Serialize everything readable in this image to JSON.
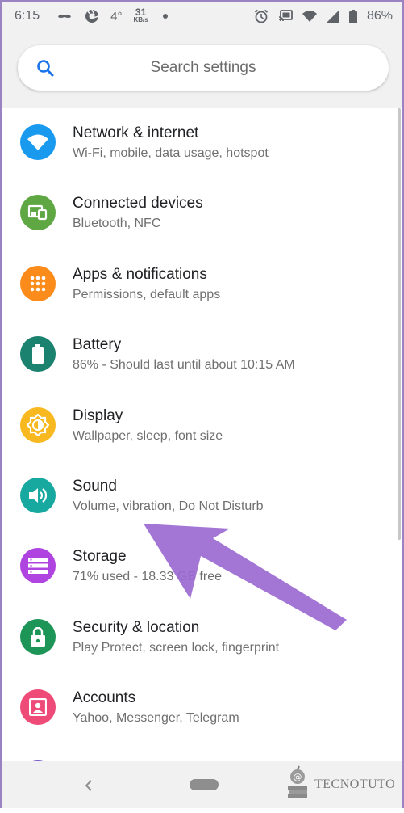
{
  "status_bar": {
    "time": "6:15",
    "temperature": "4°",
    "data_speed_value": "31",
    "data_speed_unit": "KB/s",
    "battery_percent": "86%",
    "icons": [
      "mustache-icon",
      "camera-shutter-icon",
      "dot-icon",
      "alarm-icon",
      "cast-icon",
      "wifi-icon",
      "signal-icon",
      "battery-icon"
    ]
  },
  "search": {
    "placeholder": "Search settings",
    "icon": "search-icon",
    "accent": "#1a73e8"
  },
  "settings": [
    {
      "title": "Network & internet",
      "subtitle": "Wi-Fi, mobile, data usage, hotspot",
      "icon": "wifi-icon",
      "color": "#1a9aef"
    },
    {
      "title": "Connected devices",
      "subtitle": "Bluetooth, NFC",
      "icon": "devices-icon",
      "color": "#5fa743"
    },
    {
      "title": "Apps & notifications",
      "subtitle": "Permissions, default apps",
      "icon": "apps-grid-icon",
      "color": "#fb8c1c"
    },
    {
      "title": "Battery",
      "subtitle": "86% - Should last until about 10:15 AM",
      "icon": "battery-icon",
      "color": "#1b8270"
    },
    {
      "title": "Display",
      "subtitle": "Wallpaper, sleep, font size",
      "icon": "brightness-icon",
      "color": "#f8b81f"
    },
    {
      "title": "Sound",
      "subtitle": "Volume, vibration, Do Not Disturb",
      "icon": "volume-icon",
      "color": "#17a8a0"
    },
    {
      "title": "Storage",
      "subtitle": "71% used - 18.33 GB free",
      "icon": "storage-icon",
      "color": "#b044e0"
    },
    {
      "title": "Security & location",
      "subtitle": "Play Protect, screen lock, fingerprint",
      "icon": "lock-icon",
      "color": "#1d9557"
    },
    {
      "title": "Accounts",
      "subtitle": "Yahoo, Messenger, Telegram",
      "icon": "account-icon",
      "color": "#ee4b78"
    }
  ],
  "annotation": {
    "arrow_color": "#9b6ad1",
    "arrow_target": "Sound"
  },
  "nav_bar": {
    "back_icon": "back-chevron-icon",
    "home_icon": "home-pill-icon"
  },
  "watermark": {
    "text": "TECNOTUTO"
  }
}
